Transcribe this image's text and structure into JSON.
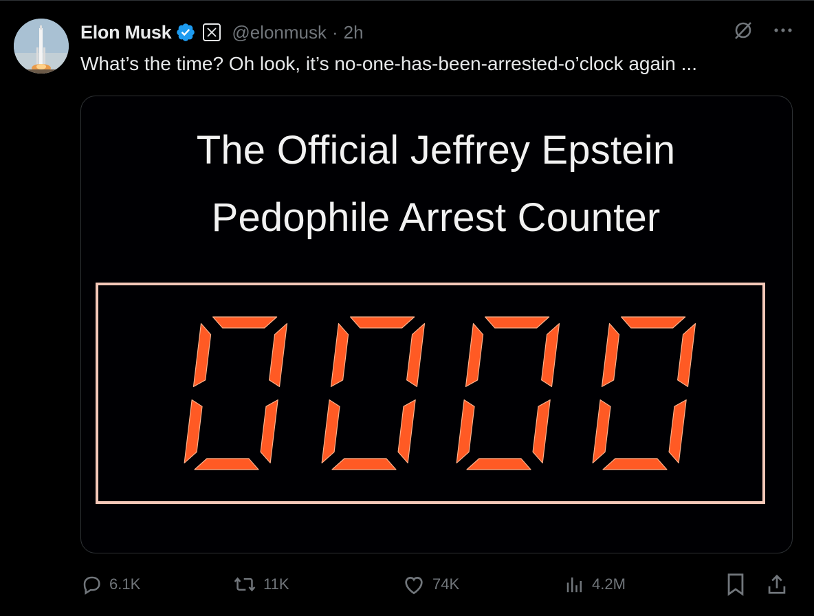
{
  "author": {
    "name": "Elon Musk",
    "handle": "@elonmusk",
    "separator": "·",
    "time": "2h",
    "verified": true
  },
  "tweet": {
    "text": "What’s the time? Oh look, it’s no-one-has-been-arrested-o’clock again ..."
  },
  "media": {
    "title_line1": "The Official Jeffrey Epstein",
    "title_line2": "Pedophile Arrest Counter",
    "counter_value": "0000",
    "counter_color": "#ff5a24",
    "frame_color": "#f3c7b8"
  },
  "actions": {
    "replies": "6.1K",
    "reposts": "11K",
    "likes": "74K",
    "views": "4.2M"
  },
  "colors": {
    "background": "#000000",
    "text": "#e7e9ea",
    "muted": "#71767b",
    "verified_blue": "#1d9bf0"
  }
}
